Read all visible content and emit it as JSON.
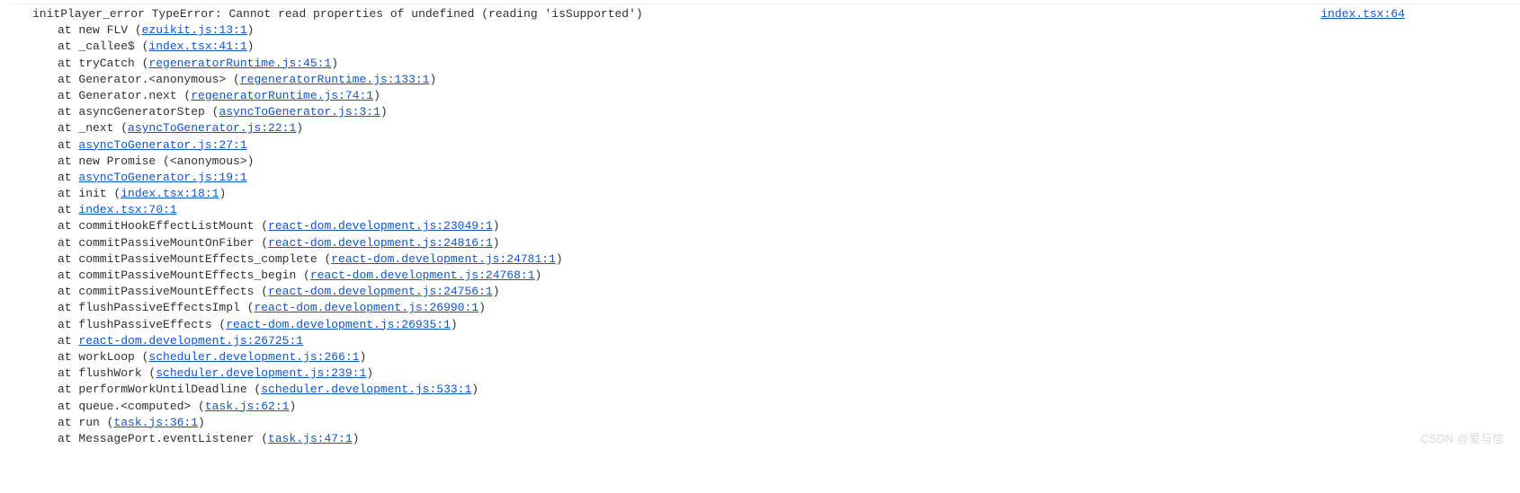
{
  "error": {
    "prefix": "initPlayer_error ",
    "message": "TypeError: Cannot read properties of undefined (reading 'isSupported')",
    "source_link": "index.tsx:64"
  },
  "stack": [
    {
      "prefix": "at new FLV (",
      "link": "ezuikit.js:13:1",
      "suffix": ")"
    },
    {
      "prefix": "at _callee$ (",
      "link": "index.tsx:41:1",
      "suffix": ")"
    },
    {
      "prefix": "at tryCatch (",
      "link": "regeneratorRuntime.js:45:1",
      "suffix": ")"
    },
    {
      "prefix": "at Generator.<anonymous> (",
      "link": "regeneratorRuntime.js:133:1",
      "suffix": ")"
    },
    {
      "prefix": "at Generator.next (",
      "link": "regeneratorRuntime.js:74:1",
      "suffix": ")"
    },
    {
      "prefix": "at asyncGeneratorStep (",
      "link": "asyncToGenerator.js:3:1",
      "suffix": ")"
    },
    {
      "prefix": "at _next (",
      "link": "asyncToGenerator.js:22:1",
      "suffix": ")"
    },
    {
      "prefix": "at ",
      "link": "asyncToGenerator.js:27:1",
      "suffix": ""
    },
    {
      "prefix": "at new Promise (<anonymous>)",
      "link": "",
      "suffix": ""
    },
    {
      "prefix": "at ",
      "link": "asyncToGenerator.js:19:1",
      "suffix": ""
    },
    {
      "prefix": "at init (",
      "link": "index.tsx:18:1",
      "suffix": ")"
    },
    {
      "prefix": "at ",
      "link": "index.tsx:70:1",
      "suffix": ""
    },
    {
      "prefix": "at commitHookEffectListMount (",
      "link": "react-dom.development.js:23049:1",
      "suffix": ")"
    },
    {
      "prefix": "at commitPassiveMountOnFiber (",
      "link": "react-dom.development.js:24816:1",
      "suffix": ")"
    },
    {
      "prefix": "at commitPassiveMountEffects_complete (",
      "link": "react-dom.development.js:24781:1",
      "suffix": ")"
    },
    {
      "prefix": "at commitPassiveMountEffects_begin (",
      "link": "react-dom.development.js:24768:1",
      "suffix": ")"
    },
    {
      "prefix": "at commitPassiveMountEffects (",
      "link": "react-dom.development.js:24756:1",
      "suffix": ")"
    },
    {
      "prefix": "at flushPassiveEffectsImpl (",
      "link": "react-dom.development.js:26990:1",
      "suffix": ")"
    },
    {
      "prefix": "at flushPassiveEffects (",
      "link": "react-dom.development.js:26935:1",
      "suffix": ")"
    },
    {
      "prefix": "at ",
      "link": "react-dom.development.js:26725:1",
      "suffix": ""
    },
    {
      "prefix": "at workLoop (",
      "link": "scheduler.development.js:266:1",
      "suffix": ")"
    },
    {
      "prefix": "at flushWork (",
      "link": "scheduler.development.js:239:1",
      "suffix": ")"
    },
    {
      "prefix": "at performWorkUntilDeadline (",
      "link": "scheduler.development.js:533:1",
      "suffix": ")"
    },
    {
      "prefix": "at queue.<computed> (",
      "link": "task.js:62:1",
      "suffix": ")"
    },
    {
      "prefix": "at run (",
      "link": "task.js:36:1",
      "suffix": ")"
    },
    {
      "prefix": "at MessagePort.eventListener (",
      "link": "task.js:47:1",
      "suffix": ")"
    }
  ],
  "watermark": "CSDN @爱与信"
}
